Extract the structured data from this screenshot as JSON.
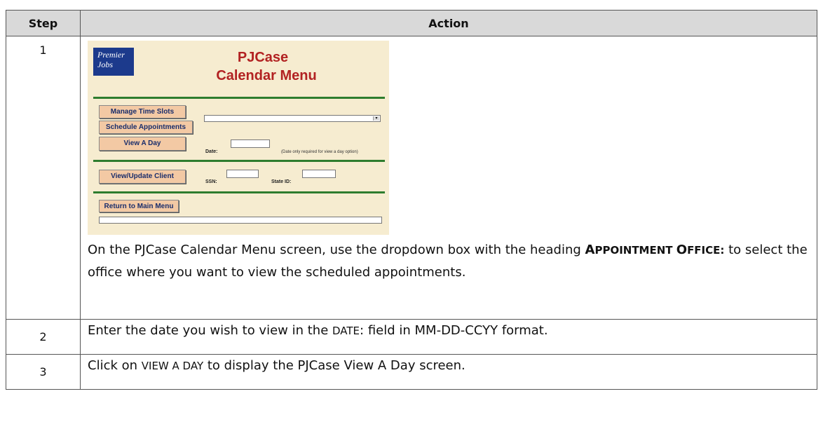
{
  "table": {
    "header_step": "Step",
    "header_action": "Action"
  },
  "screenshot": {
    "logo_text": "Premier Jobs",
    "title_line1": "PJCase",
    "title_line2": "Calendar Menu",
    "buttons": {
      "manage_time_slots": "Manage Time Slots",
      "schedule_appointments": "Schedule Appointments",
      "view_a_day": "View A Day",
      "view_update_client": "View/Update Client",
      "return_main_menu": "Return to Main Menu"
    },
    "labels": {
      "appointment_office": "Appointment Office:",
      "date": "Date:",
      "date_note": "(Date only required for view a day option)",
      "ssn": "SSN:",
      "state_id": "State ID:"
    }
  },
  "rows": [
    {
      "step": "1",
      "text_before": "On the PJCase Calendar Menu screen, use the dropdown box with the heading ",
      "emph_a": "A",
      "emph_b": "PPOINTMENT ",
      "emph_c": "O",
      "emph_d": "FFICE:",
      "text_after": " to select the office where you want to view the scheduled appointments."
    },
    {
      "step": "2",
      "text_before": "Enter the date you wish to view in the ",
      "sc": "DATE",
      "text_after": ": field in MM-DD-CCYY format."
    },
    {
      "step": "3",
      "text_before": "Click on ",
      "sc": "VIEW A DAY",
      "text_after": " to display the PJCase View A Day screen."
    }
  ]
}
